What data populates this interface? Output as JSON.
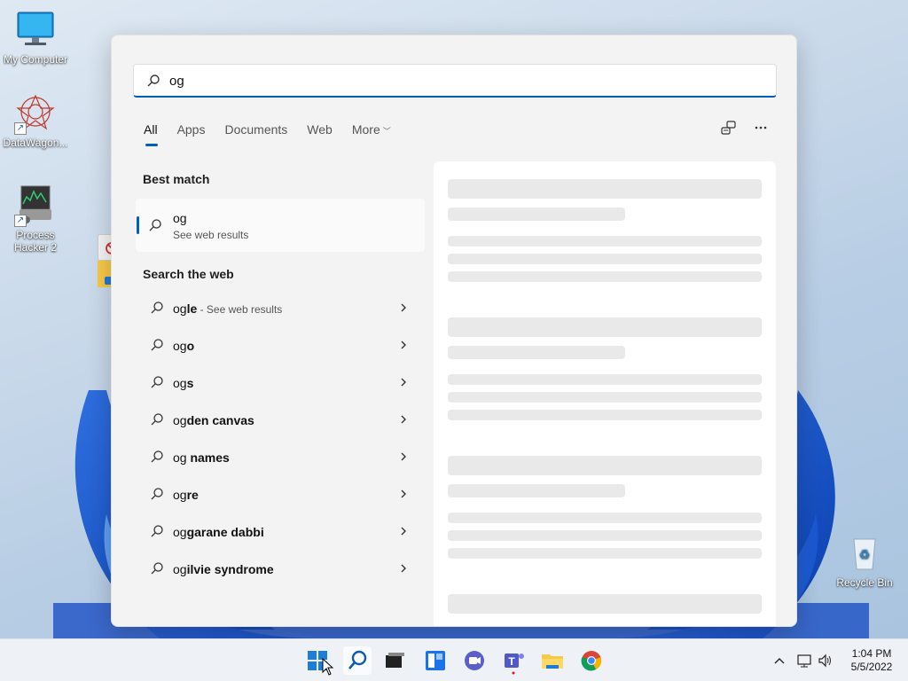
{
  "desktop": {
    "icons": [
      {
        "label": "My Computer"
      },
      {
        "label": "DataWagon..."
      },
      {
        "label": "Process Hacker 2"
      },
      {
        "label": "Recycle Bin"
      }
    ]
  },
  "search": {
    "query": "og",
    "tabs": [
      {
        "label": "All"
      },
      {
        "label": "Apps"
      },
      {
        "label": "Documents"
      },
      {
        "label": "Web"
      },
      {
        "label": "More"
      }
    ],
    "best_match": {
      "heading": "Best match",
      "title": "og",
      "subtitle": "See web results"
    },
    "web": {
      "heading": "Search the web",
      "items": [
        {
          "prefix": "og",
          "rest": "le",
          "suffix": " - See web results"
        },
        {
          "prefix": "og",
          "rest": "o",
          "suffix": ""
        },
        {
          "prefix": "og",
          "rest": "s",
          "suffix": ""
        },
        {
          "prefix": "og",
          "rest": "den canvas",
          "suffix": ""
        },
        {
          "prefix": "og",
          "rest": " names",
          "suffix": ""
        },
        {
          "prefix": "og",
          "rest": "re",
          "suffix": ""
        },
        {
          "prefix": "og",
          "rest": "garane dabbi",
          "suffix": ""
        },
        {
          "prefix": "og",
          "rest": "ilvie syndrome",
          "suffix": ""
        }
      ]
    }
  },
  "taskbar": {
    "icons": [
      "windows-start-icon",
      "search-icon",
      "task-view-icon",
      "widgets-icon",
      "chat-icon",
      "teams-icon",
      "file-explorer-icon",
      "chrome-icon"
    ],
    "tray_icons": [
      "chevron-up-icon",
      "network-icon",
      "volume-icon"
    ],
    "time": "1:04 PM",
    "date": "5/5/2022"
  },
  "colors": {
    "accent": "#005fb8"
  }
}
